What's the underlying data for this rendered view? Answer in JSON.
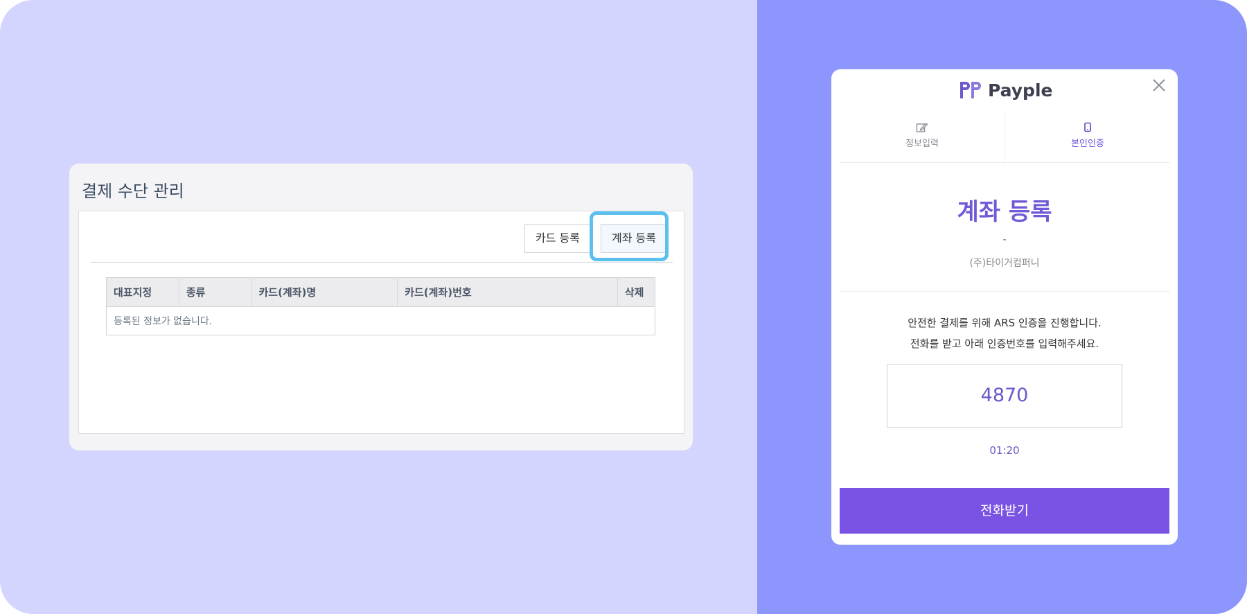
{
  "management": {
    "title": "결제 수단 관리",
    "card_register_label": "카드 등록",
    "account_register_label": "계좌 등록",
    "table": {
      "headers": [
        "대표지정",
        "종류",
        "카드(계좌)명",
        "카드(계좌)번호",
        "삭제"
      ],
      "empty_text": "등록된 정보가 없습니다."
    }
  },
  "modal": {
    "brand": "Payple",
    "brand_logo_icon": "payple-logo",
    "close_icon": "close-icon",
    "tabs": [
      {
        "label": "정보입력",
        "icon": "edit-icon",
        "active": false
      },
      {
        "label": "본인인증",
        "icon": "mobile-phone-icon",
        "active": true
      }
    ],
    "title": "계좌 등록",
    "dash": "-",
    "company": "(주)타이거컴퍼니",
    "message_line1": "안전한 결제를 위해 ARS 인증을 진행합니다.",
    "message_line2": "전화를 받고 아래 인증번호를 입력해주세요.",
    "auth_code": "4870",
    "timer": "01:20",
    "call_button_label": "전화받기"
  },
  "colors": {
    "background_left": "#d3d5fe",
    "background_right": "#8c96fd",
    "accent_purple": "#7a52e4",
    "highlight_blue": "#5bc0ee"
  }
}
